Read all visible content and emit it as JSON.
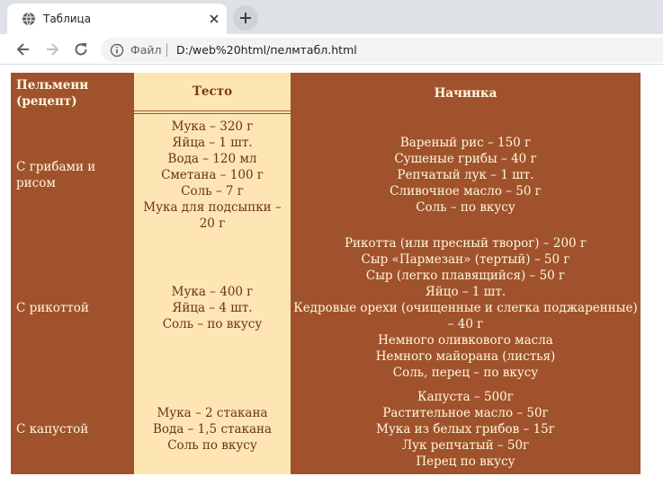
{
  "browser": {
    "tab_title": "Таблица",
    "scheme_label": "Файл",
    "url": "D:/web%20html/пелмтабл.html"
  },
  "table": {
    "headers": [
      "Пельмени (рецепт)",
      "Тесто",
      "Начинка"
    ],
    "rows": [
      {
        "name": "С грибами и рисом",
        "dough": [
          "Мука – 320 г",
          "Яйца – 1 шт.",
          "Вода – 120 мл",
          "Сметана – 100 г",
          "Соль – 7 г",
          "Мука для подсыпки – 20 г"
        ],
        "filling": [
          "Вареный рис – 150 г",
          "Сушеные грибы – 40 г",
          "Репчатый лук – 1 шт.",
          "Сливочное масло – 50 г",
          "Соль – по вкусу"
        ]
      },
      {
        "name": "С рикоттой",
        "dough": [
          "Мука – 400 г",
          "Яйца – 4 шт.",
          "Соль – по вкусу"
        ],
        "filling": [
          "Рикотта (или пресный творог) – 200 г",
          "Сыр «Пармезан» (тертый) – 50 г",
          "Сыр (легко плавящийся) – 50 г",
          "Яйцо – 1 шт.",
          "Кедровые орехи (очищенные и слегка поджаренные) – 40 г",
          "Немного оливкового масла",
          "Немного майорана (листья)",
          "Соль, перец – по вкусу"
        ]
      },
      {
        "name": "С капустой",
        "dough": [
          "Мука – 2 стакана",
          "Вода – 1,5 стакана",
          "Соль по вкусу"
        ],
        "filling": [
          "Капуста – 500г",
          "Растительное масло – 50г",
          "Мука из белых грибов – 15г",
          "Лук репчатый – 50г",
          "Перец по вкусу"
        ]
      }
    ]
  },
  "colors": {
    "table_bg": "#a0522d",
    "dough_bg": "#fde5b4",
    "text_light": "#fff8dc"
  }
}
